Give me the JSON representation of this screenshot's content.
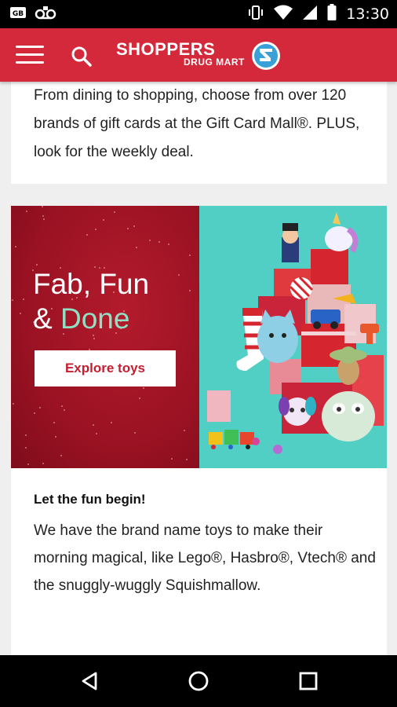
{
  "status_bar": {
    "time": "13:30",
    "left_icons": [
      "sim-icon",
      "voicemail-icon"
    ],
    "right_icons": [
      "vibrate-icon",
      "wifi-icon",
      "signal-icon",
      "battery-icon"
    ]
  },
  "header": {
    "brand_line1": "SHOPPERS",
    "brand_line2": "DRUG MART",
    "menu_icon": "menu-icon",
    "search_icon": "search-icon",
    "brand_color": "#d4293b"
  },
  "gift_card": {
    "text": "From dining to shopping, choose from over 120 brands of gift cards at the Gift Card Mall®. PLUS, look for the weekly deal."
  },
  "toys_promo": {
    "headline_line1": "Fab, Fun",
    "headline_amp": "& ",
    "headline_done": "Done",
    "cta_label": "Explore toys",
    "title": "Let the fun begin!",
    "body": "We have the brand name toys to make their morning magical, like Lego®, Hasbro®, Vtech® and the snuggly-wuggly Squishmallow.",
    "accent_done_color": "#8fe0c4",
    "banner_bg_color": "#9a1223",
    "image_bg_color": "#52cfc4"
  },
  "nav_bar": {
    "items": [
      "back-icon",
      "home-icon",
      "recents-icon"
    ]
  }
}
